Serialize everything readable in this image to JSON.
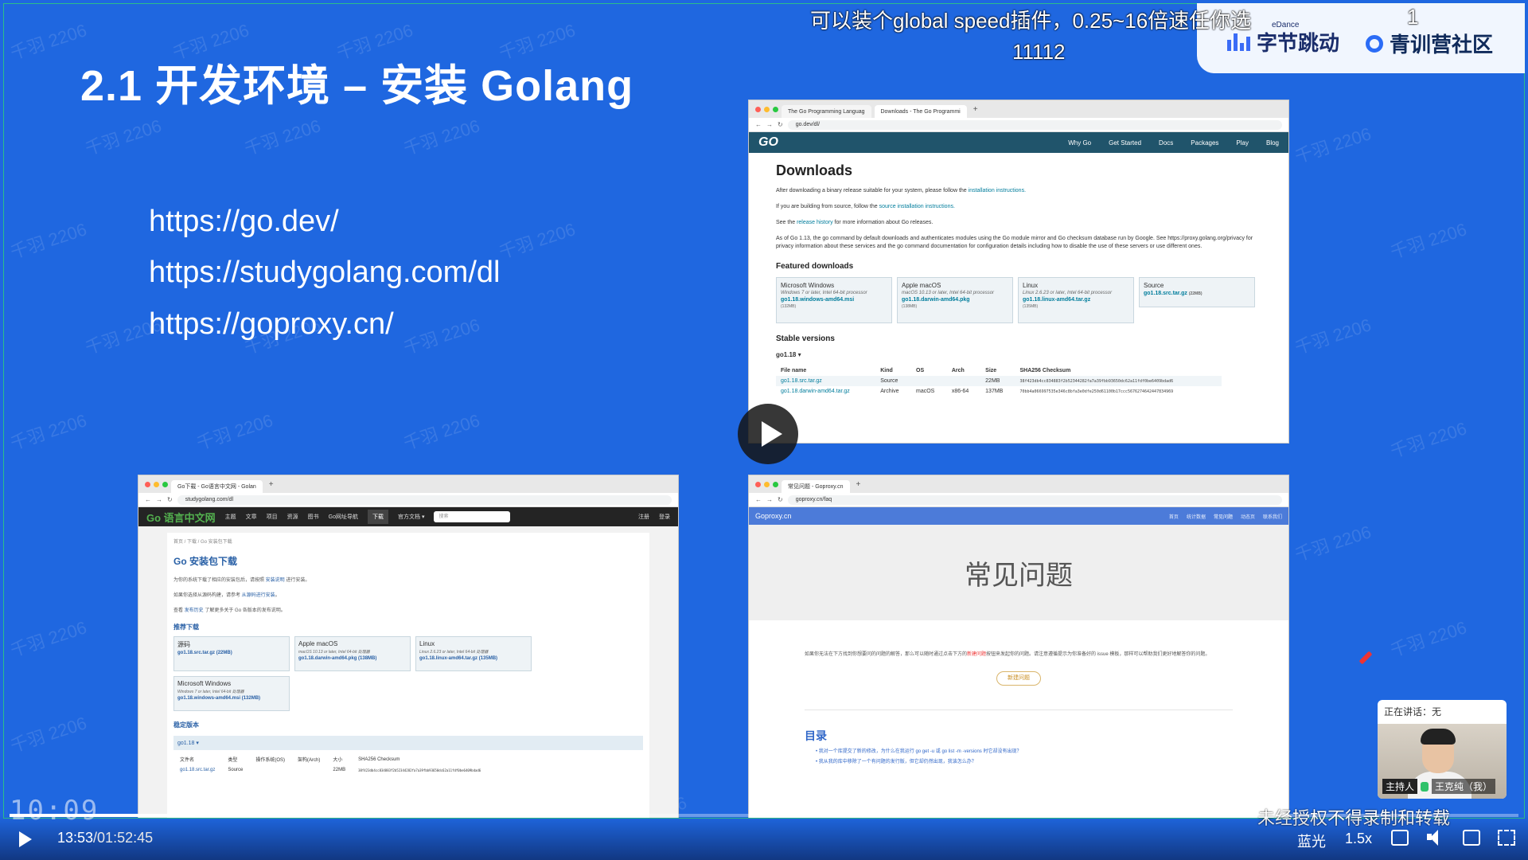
{
  "slide": {
    "title": "2.1 开发环境 – 安装 Golang",
    "urls": [
      "https://go.dev/",
      "https://studygolang.com/dl",
      "https://goproxy.cn/"
    ],
    "watermark": "千羽 2206"
  },
  "brand": {
    "bytedance_small": "eDance",
    "bytedance_name": "字节跳动",
    "community_name": "青训营社区"
  },
  "danmaku": [
    "可以装个global speed插件，0.25~16倍速任你选",
    "11112",
    "1"
  ],
  "godev": {
    "tabs": [
      "The Go Programming Languag",
      "Downloads - The Go Programmi"
    ],
    "address": "go.dev/dl/",
    "nav": [
      "Why Go",
      "Get Started",
      "Docs",
      "Packages",
      "Play",
      "Blog"
    ],
    "logo": "GO",
    "title": "Downloads",
    "p1a": "After downloading a binary release suitable for your system, please follow the ",
    "p1link": "installation instructions.",
    "p2a": "If you are building from source, follow the ",
    "p2link": "source installation instructions.",
    "p3a": "See the ",
    "p3link": "release history",
    "p3b": " for more information about Go releases.",
    "p4": "As of Go 1.13, the go command by default downloads and authenticates modules using the Go module mirror and Go checksum database run by Google. See https://proxy.golang.org/privacy for privacy information about these services and the go command documentation for configuration details including how to disable the use of these servers or use different ones.",
    "featured_title": "Featured downloads",
    "featured": [
      {
        "os": "Microsoft Windows",
        "sub": "Windows 7 or later, Intel 64-bit processor",
        "file": "go1.18.windows-amd64.msi",
        "size": "(132MB)"
      },
      {
        "os": "Apple macOS",
        "sub": "macOS 10.13 or later, Intel 64-bit processor",
        "file": "go1.18.darwin-amd64.pkg",
        "size": "(138MB)"
      },
      {
        "os": "Linux",
        "sub": "Linux 2.6.23 or later, Intel 64-bit processor",
        "file": "go1.18.linux-amd64.tar.gz",
        "size": "(135MB)"
      },
      {
        "os": "Source",
        "sub": "",
        "file": "go1.18.src.tar.gz",
        "size": "(22MB)"
      }
    ],
    "stable_title": "Stable versions",
    "version": "go1.18 ▾",
    "table_headers": [
      "File name",
      "Kind",
      "OS",
      "Arch",
      "Size",
      "SHA256 Checksum"
    ],
    "table_rows": [
      [
        "go1.18.src.tar.gz",
        "Source",
        "",
        "",
        "22MB",
        "38f423db4cc834883f2b52344282fa7a39fbb93650dc62a11fdf0be6409bdad6"
      ],
      [
        "go1.18.darwin-amd64.tar.gz",
        "Archive",
        "macOS",
        "x86-64",
        "137MB",
        "70bb4a066997535e346c8bfa3e0dfe250d61100b17ccc5676274642447834969"
      ]
    ]
  },
  "studygo": {
    "tab": "Go下载 - Go语言中文网 - Golan",
    "address": "studygolang.com/dl",
    "logo": "Go 语言中文网",
    "nav": [
      "主题",
      "文章",
      "项目",
      "资源",
      "图书",
      "Go网址导航",
      "下载",
      "官方文档 ▾"
    ],
    "search": "搜索",
    "auth": [
      "注册",
      "登录"
    ],
    "breadcrumb": "首页  /  下载  /  Go 安装包下载",
    "title": "Go 安装包下载",
    "p1a": "为你的系统下载了相应的安装包后，请按照 ",
    "p1link": "安装说明",
    "p1b": " 进行安装。",
    "p2a": "如果你选择从源码构建，请参考 ",
    "p2link": "从源码进行安装",
    "p2b": "。",
    "p3a": "查看 ",
    "p3link": "发布历史",
    "p3b": " 了解更多关于 Go 各版本的发布说明。",
    "featured_title": "推荐下载",
    "featured": [
      {
        "os": "源码",
        "sub": "",
        "file": "go1.18.src.tar.gz",
        "size": "(22MB)"
      },
      {
        "os": "Apple macOS",
        "sub": "macOS 10.13 or later, Intel 64-bit 处理器",
        "file": "go1.18.darwin-amd64.pkg",
        "size": "(138MB)"
      },
      {
        "os": "Linux",
        "sub": "Linux 2.6.23 or later, Intel 64-bit 处理器",
        "file": "go1.18.linux-amd64.tar.gz",
        "size": "(135MB)"
      },
      {
        "os": "Microsoft Windows",
        "sub": "Windows 7 or later, Intel 64-bit 处理器",
        "file": "go1.18.windows-amd64.msi",
        "size": "(132MB)"
      }
    ],
    "stable_title": "稳定版本",
    "version": "go1.18 ▾",
    "table_headers": [
      "文件名",
      "类型",
      "操作系统(OS)",
      "架构(Arch)",
      "大小",
      "SHA256 Checksum"
    ],
    "table_row": [
      "go1.18.src.tar.gz",
      "Source",
      "",
      "",
      "22MB",
      "38f423db4cc834883f2b52344282fa7a39fbb93650dc62a11fdf0be6409bdad6"
    ]
  },
  "goproxy": {
    "tab": "常见问题 - Goproxy.cn",
    "address": "goproxy.cn/faq",
    "brand": "Goproxy.cn",
    "nav": [
      "首页",
      "统计数据",
      "常见问题",
      "动态页",
      "联系我们"
    ],
    "hero": "常见问题",
    "intro_a": "如果你无法在下方找到你想要问的问题的解答，那么可以随时通过点击下方的",
    "intro_red": "新建问题",
    "intro_b": "按钮来发起你的问题。请注意遵循提示为你准备好的 issue 模板，那样可以帮助我们更好地解答你的问题。",
    "button": "新建问题",
    "toc_title": "目录",
    "toc": [
      "我对一个库提交了新的修改，为什么在我运行 go get -u 或 go list -m -versions 时它却没有出现？",
      "我从我的库中移除了一个有问题的发行版，但它却仍然出现，我该怎么办？"
    ]
  },
  "speaker": {
    "speaking": "正在讲话：无",
    "role": "主持人",
    "name": "王克纯（我）"
  },
  "player": {
    "clock": "10:09",
    "current_time": "13:53",
    "duration": "/01:52:45",
    "progress": 0.123,
    "notice": "未经授权不得录制和转载",
    "quality": "蓝光",
    "speed": "1.5x"
  }
}
